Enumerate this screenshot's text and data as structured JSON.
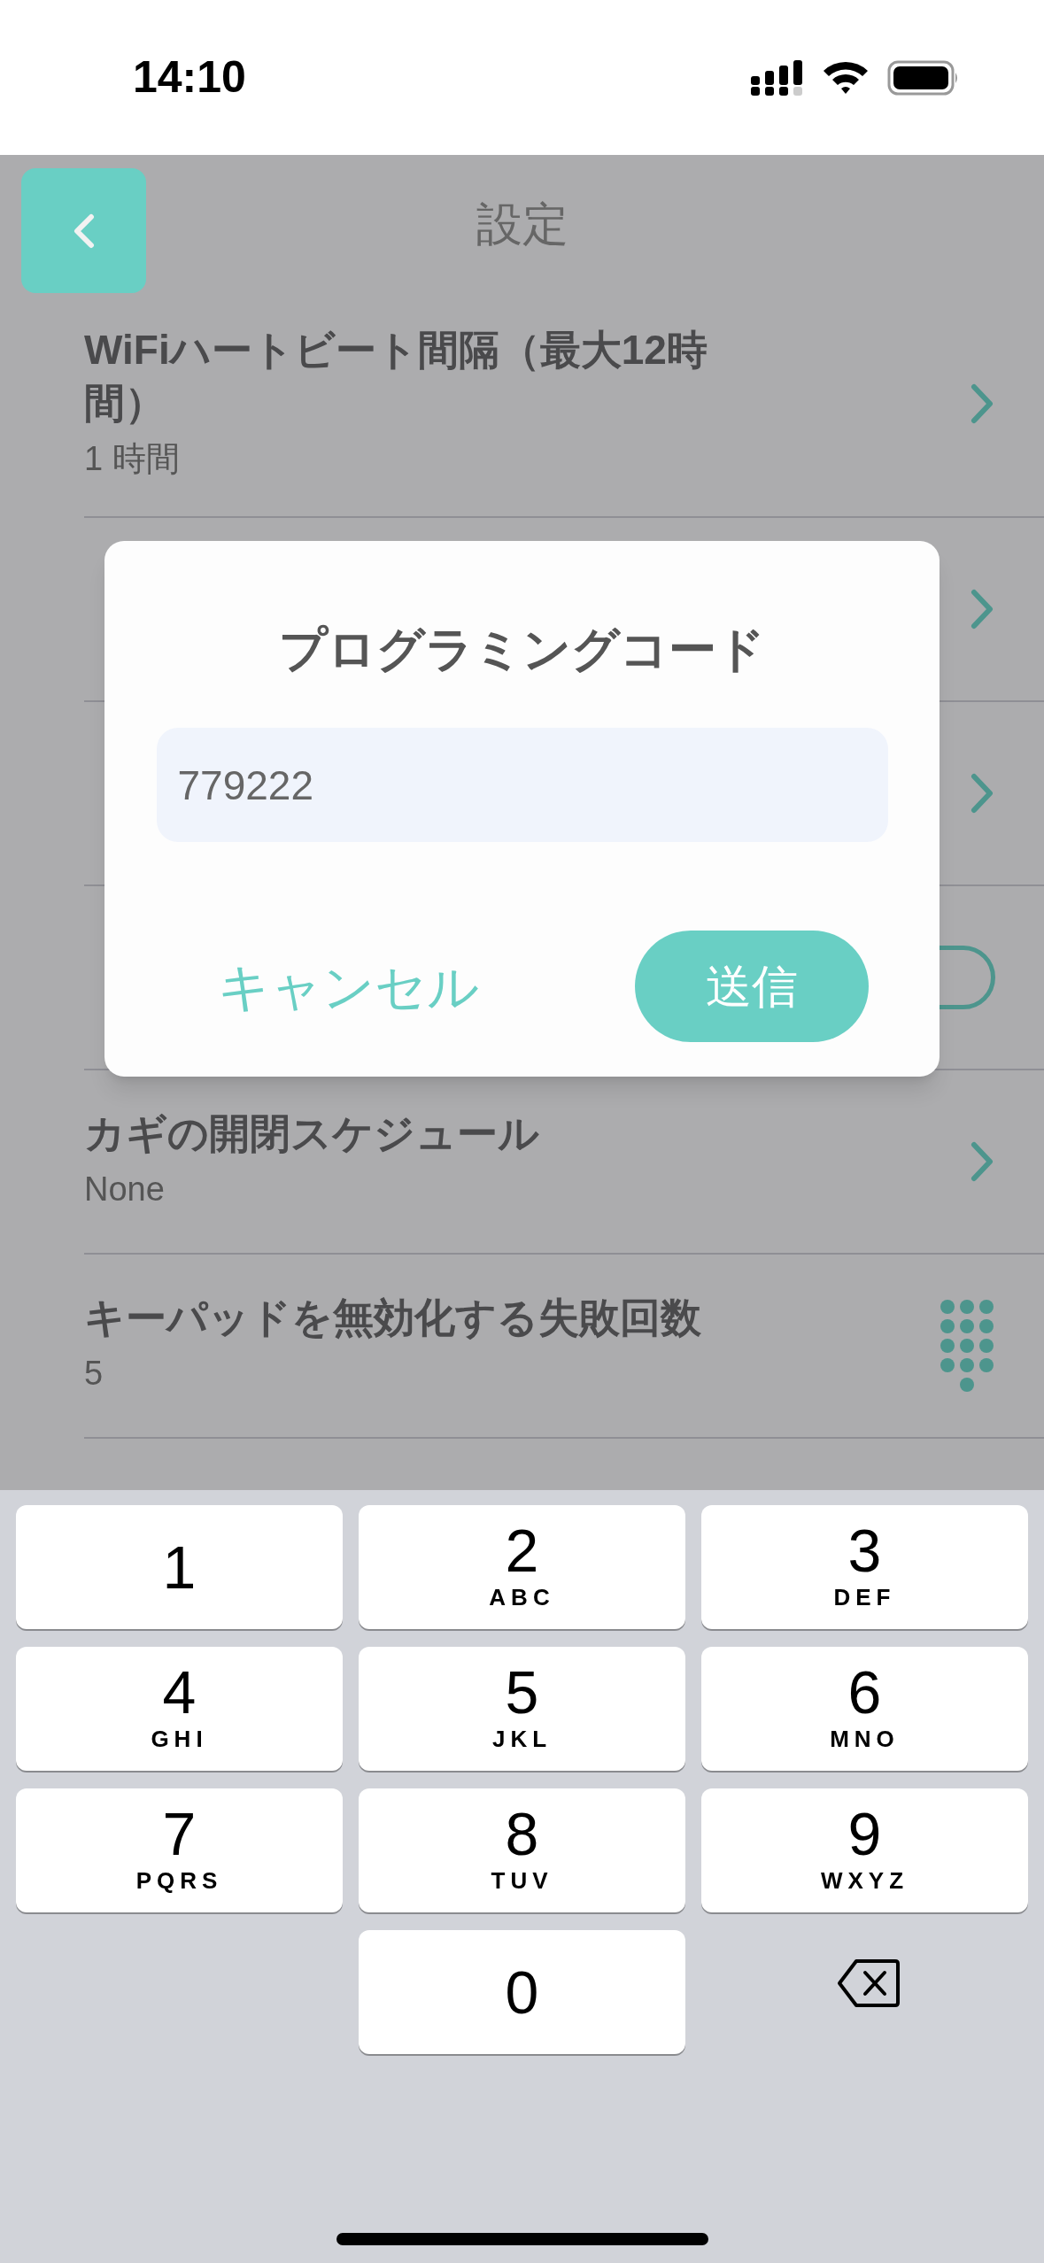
{
  "status_bar": {
    "time": "14:10"
  },
  "header": {
    "title": "設定"
  },
  "settings": [
    {
      "kind": "chevron",
      "title": "WiFiハートビート間隔（最大12時間）",
      "value": "1 時間"
    },
    {
      "kind": "chevron"
    },
    {
      "kind": "chevron"
    },
    {
      "kind": "toggle",
      "on": false
    },
    {
      "kind": "chevron",
      "title": "カギの開閉スケジュール",
      "value": "None"
    },
    {
      "kind": "keypad",
      "title": "キーパッドを無効化する失敗回数",
      "value": "5"
    }
  ],
  "dialog": {
    "title": "プログラミングコード",
    "value": "779222",
    "cancel": "キャンセル",
    "submit": "送信"
  },
  "keypad": [
    {
      "digit": "1"
    },
    {
      "digit": "2",
      "letters": "ABC"
    },
    {
      "digit": "3",
      "letters": "DEF"
    },
    {
      "digit": "4",
      "letters": "GHI"
    },
    {
      "digit": "5",
      "letters": "JKL"
    },
    {
      "digit": "6",
      "letters": "MNO"
    },
    {
      "digit": "7",
      "letters": "PQRS"
    },
    {
      "digit": "8",
      "letters": "TUV"
    },
    {
      "digit": "9",
      "letters": "WXYZ"
    },
    {
      "digit": "0"
    }
  ]
}
